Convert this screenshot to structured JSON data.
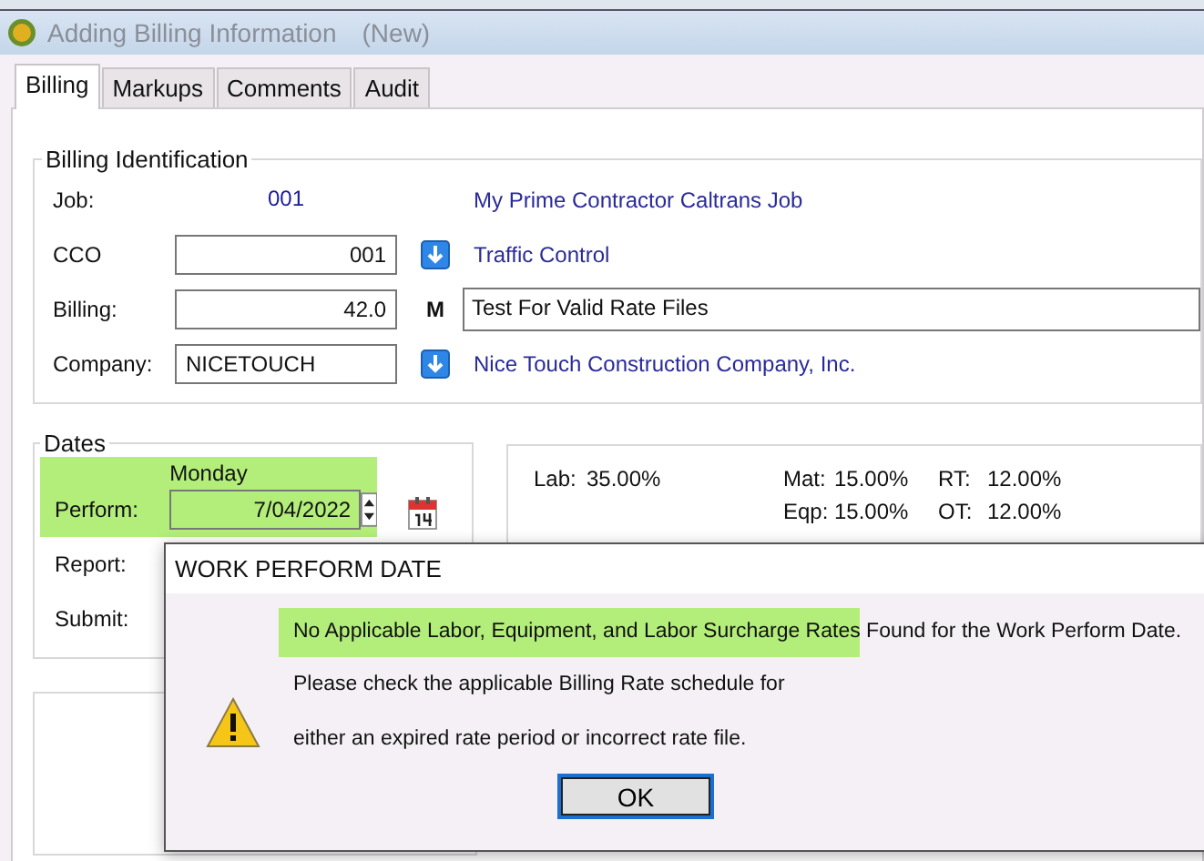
{
  "window": {
    "title": "Adding Billing Information",
    "status": "(New)"
  },
  "tabs": [
    {
      "label": "Billing",
      "selected": true
    },
    {
      "label": "Markups",
      "selected": false
    },
    {
      "label": "Comments",
      "selected": false
    },
    {
      "label": "Audit",
      "selected": false
    }
  ],
  "billing_identification": {
    "legend": "Billing Identification",
    "rows": [
      {
        "kind": "static",
        "label": "Job:",
        "value": "001",
        "description": "My Prime Contractor Caltrans Job"
      },
      {
        "kind": "lookup",
        "label": "CCO",
        "value": "001",
        "description": "Traffic Control"
      },
      {
        "kind": "marked",
        "label": "Billing:",
        "value": "42.0",
        "marker": "M",
        "description": "Test For Valid Rate Files"
      },
      {
        "kind": "lookup_text",
        "label": "Company:",
        "value": "NICETOUCH",
        "description": "Nice Touch Construction Company, Inc."
      }
    ]
  },
  "dates": {
    "legend": "Dates",
    "weekday": "Monday",
    "highlighted": true,
    "rows": [
      {
        "label": "Perform:",
        "value": "7/04/2022"
      },
      {
        "label": "Report:"
      },
      {
        "label": "Submit:"
      }
    ]
  },
  "rates": [
    {
      "label": "Lab:",
      "value": "35.00%"
    },
    {
      "label": "Mat:",
      "value": "15.00%"
    },
    {
      "label": "RT:",
      "value": "12.00%"
    },
    {
      "label": "Eqp:",
      "value": "15.00%"
    },
    {
      "label": "OT:",
      "value": "12.00%"
    }
  ],
  "dialog": {
    "title": "WORK PERFORM DATE",
    "message": [
      {
        "text": "No Applicable Labor, Equipment, and Labor Surcharge Rates",
        "highlighted": true
      },
      {
        "text": " Found for the Work Perform Date.",
        "highlighted": false
      }
    ],
    "lines": [
      "Please check the applicable Billing Rate schedule for",
      "either an expired rate period or incorrect rate file."
    ],
    "button": "OK"
  }
}
